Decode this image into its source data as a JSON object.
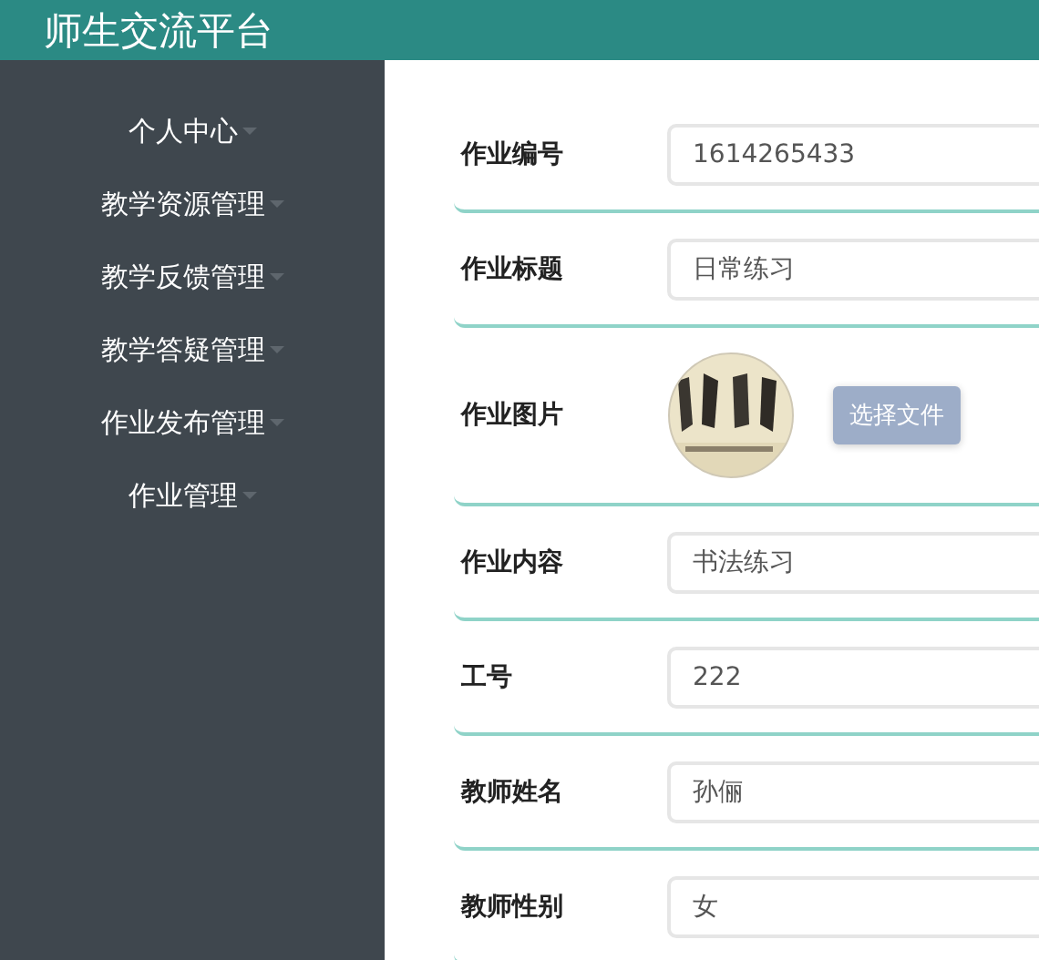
{
  "header": {
    "title": "师生交流平台"
  },
  "sidebar": {
    "items": [
      {
        "label": "个人中心"
      },
      {
        "label": "教学资源管理"
      },
      {
        "label": "教学反馈管理"
      },
      {
        "label": "教学答疑管理"
      },
      {
        "label": "作业发布管理"
      },
      {
        "label": "作业管理"
      }
    ]
  },
  "form": {
    "fields": [
      {
        "kind": "input",
        "label": "作业编号",
        "value": "1614265433"
      },
      {
        "kind": "input",
        "label": "作业标题",
        "value": "日常练习"
      },
      {
        "label": "作业图片",
        "button": "选择文件"
      },
      {
        "kind": "input",
        "label": "作业内容",
        "value": "书法练习"
      },
      {
        "kind": "input",
        "label": "工号",
        "value": "222"
      },
      {
        "kind": "input",
        "label": "教师姓名",
        "value": "孙俪"
      },
      {
        "kind": "input",
        "label": "教师性别",
        "value": "女"
      }
    ]
  }
}
